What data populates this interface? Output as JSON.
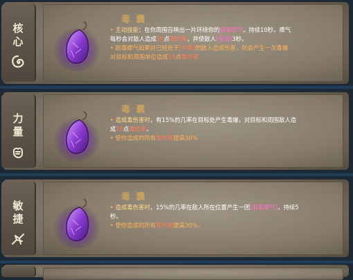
{
  "panels": [
    {
      "category": [
        "核",
        "心"
      ],
      "symbol_icon": "swirl-icon",
      "title": "毒 囊",
      "lines": [
        [
          {
            "t": "• ",
            "c": "o"
          },
          {
            "t": "主动技能",
            "c": "y"
          },
          {
            "t": "：在你周围召唤出一片环绕你的",
            "c": "ln"
          },
          {
            "t": "剧毒瘴气",
            "c": "pk"
          },
          {
            "t": "，持续10秒。瘴气",
            "c": "ln"
          }
        ],
        [
          {
            "t": "每秒会对敌人造成",
            "c": "ln"
          },
          {
            "t": "20",
            "c": "r"
          },
          {
            "t": "点",
            "c": "ln"
          },
          {
            "t": "毒伤害",
            "c": "r"
          },
          {
            "t": "，并使敌人",
            "c": "ln"
          },
          {
            "t": "[衰弱]",
            "c": "pk"
          },
          {
            "t": "3秒。",
            "c": "ln"
          }
        ],
        [
          {
            "t": "• ",
            "c": "o"
          },
          {
            "t": "剧毒瘴气如果对已经处于",
            "c": "o"
          },
          {
            "t": "[中毒]",
            "c": "r"
          },
          {
            "t": "的敌人造成伤害，则会产生一次毒爆",
            "c": "o"
          }
        ],
        [
          {
            "t": "  对目标和周围单位造成",
            "c": "o"
          },
          {
            "t": "16",
            "c": "r"
          },
          {
            "t": "点",
            "c": "o"
          },
          {
            "t": "毒伤害",
            "c": "r"
          }
        ]
      ]
    },
    {
      "category": [
        "力",
        "量"
      ],
      "symbol_icon": "fist-icon",
      "title": "毒 囊",
      "lines": [
        [
          {
            "t": "• ",
            "c": "o"
          },
          {
            "t": "造成毒伤害时",
            "c": "y"
          },
          {
            "t": "，有15%的几率在目标处产生毒爆，对目标和周围敌人造",
            "c": "ln"
          }
        ],
        [
          {
            "t": "  成",
            "c": "ln"
          },
          {
            "t": "10",
            "c": "r"
          },
          {
            "t": "点",
            "c": "ln"
          },
          {
            "t": "毒伤害",
            "c": "r"
          },
          {
            "t": "。",
            "c": "ln"
          }
        ],
        [
          {
            "t": "• ",
            "c": "o"
          },
          {
            "t": "使你造成的所有",
            "c": "o"
          },
          {
            "t": "毒伤害",
            "c": "r"
          },
          {
            "t": "提高30%",
            "c": "o"
          }
        ]
      ]
    },
    {
      "category": [
        "敏",
        "捷"
      ],
      "symbol_icon": "agility-icon",
      "title": "毒 囊",
      "lines": [
        [
          {
            "t": "• ",
            "c": "o"
          },
          {
            "t": "造成毒伤害时",
            "c": "y"
          },
          {
            "t": "，15%的几率在敌人所在位置产生一团",
            "c": "ln"
          },
          {
            "t": "[剧毒瘴气]",
            "c": "pk"
          },
          {
            "t": "，持续5",
            "c": "ln"
          }
        ],
        [
          {
            "t": "  秒。",
            "c": "ln"
          }
        ],
        [
          {
            "t": "• ",
            "c": "o"
          },
          {
            "t": "使你造成的所有",
            "c": "o"
          },
          {
            "t": "毒伤害",
            "c": "r"
          },
          {
            "t": "提高30%。",
            "c": "o"
          }
        ]
      ]
    }
  ]
}
